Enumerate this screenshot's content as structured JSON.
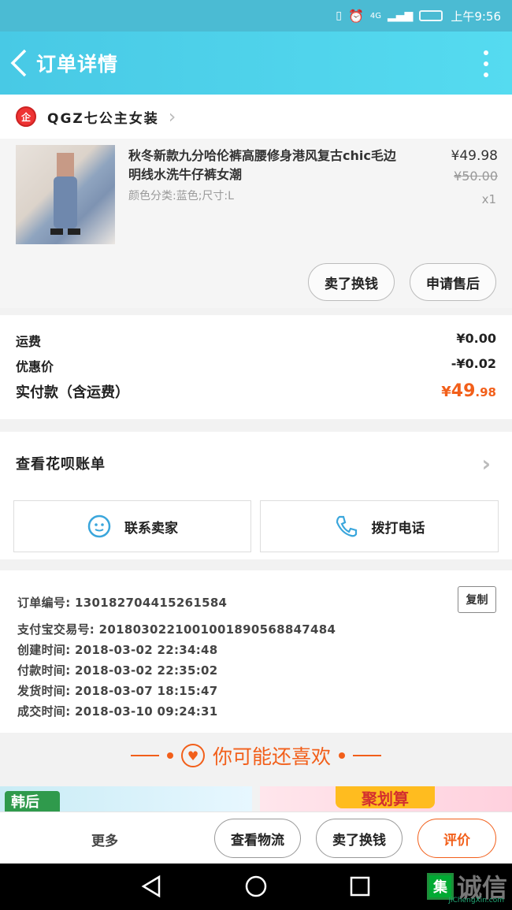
{
  "status": {
    "network": "4G",
    "time": "上午9:56"
  },
  "header": {
    "title": "订单详情"
  },
  "shop": {
    "logo_text": "企",
    "name": "QGZ七公主女装"
  },
  "item": {
    "name": "秋冬新款九分哈伦裤高腰修身港风复古chic毛边明线水洗牛仔裤女潮",
    "spec": "颜色分类:蓝色;尺寸:L",
    "price": "¥49.98",
    "original_price": "¥50.00",
    "qty": "x1",
    "buttons": {
      "refund": "卖了换钱",
      "after_sale": "申请售后"
    }
  },
  "fees": {
    "shipping_label": "运费",
    "shipping_value": "¥0.00",
    "discount_label": "优惠价",
    "discount_value": "-¥0.02",
    "total_label": "实付款（含运费）",
    "total_symbol": "¥",
    "total_int": "49",
    "total_dec": ".98"
  },
  "huabei": {
    "label": "查看花呗账单"
  },
  "contact": {
    "seller": "联系卖家",
    "call": "拨打电话"
  },
  "order_info": {
    "order_no": "订单编号: 1301827044152615​84",
    "alipay_no": "支付宝交易号: 2018030221001001890568847484",
    "created": "创建时间: 2018-03-02 22:34:48",
    "paid": "付款时间: 2018-03-02 22:35:02",
    "shipped": "发货时间: 2018-03-07 18:15:47",
    "completed": "成交时间: 2018-03-10 09:24:31",
    "copy": "复制"
  },
  "guess": {
    "title": "你可能还喜欢"
  },
  "promos": {
    "left_tag": "韩后",
    "right_tag": "聚划算"
  },
  "actions": {
    "more": "更多",
    "logistics": "查看物流",
    "sell": "卖了换钱",
    "review": "评价"
  },
  "watermark": {
    "box": "集",
    "text": "诚信",
    "sub": "JiChengXin.com"
  },
  "colors": {
    "accent": "#48c9e5",
    "price_orange": "#f25f1a"
  }
}
